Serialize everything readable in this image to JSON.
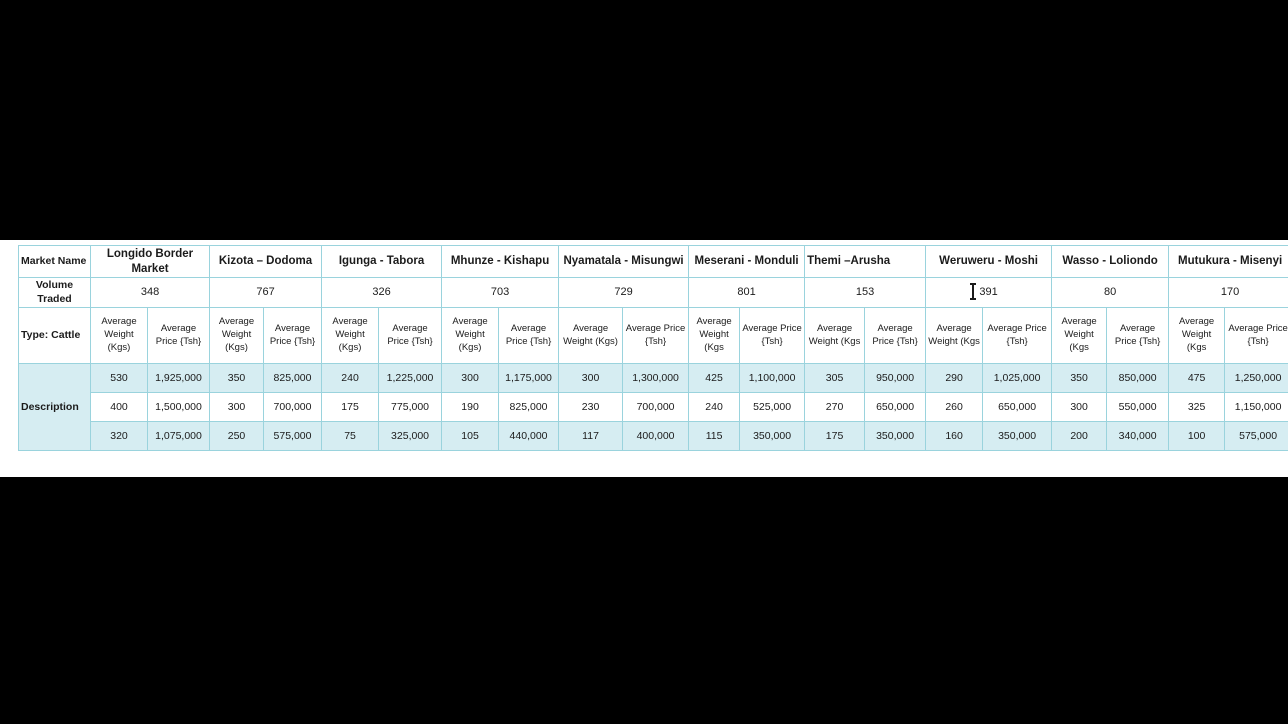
{
  "table": {
    "row_labels": {
      "market_name": "Market Name",
      "volume_traded": "Volume Traded",
      "type": "Type: Cattle",
      "description": "Description"
    },
    "sub_headers": {
      "weight": "Average Weight (Kgs)",
      "price": "Average Price {Tsh}"
    },
    "markets": [
      {
        "name": "Longido Border Market",
        "volume": "348",
        "weight_header": "Average Weight (Kgs)",
        "price_header": "Average Price {Tsh}",
        "weights": [
          "530",
          "400",
          "320"
        ],
        "prices": [
          "1,925,000",
          "1,500,000",
          "1,075,000"
        ]
      },
      {
        "name": "Kizota – Dodoma",
        "volume": "767",
        "weight_header": "Average Weight (Kgs)",
        "price_header": "Average Price {Tsh}",
        "weights": [
          "350",
          "300",
          "250"
        ],
        "prices": [
          "825,000",
          "700,000",
          "575,000"
        ]
      },
      {
        "name": "Igunga - Tabora",
        "volume": "326",
        "weight_header": "Average Weight (Kgs)",
        "price_header": "Average Price {Tsh}",
        "weights": [
          "240",
          "175",
          "75"
        ],
        "prices": [
          "1,225,000",
          "775,000",
          "325,000"
        ]
      },
      {
        "name": "Mhunze - Kishapu",
        "volume": "703",
        "weight_header": "Average Weight (Kgs)",
        "price_header": "Average Price {Tsh}",
        "weights": [
          "300",
          "190",
          "105"
        ],
        "prices": [
          "1,175,000",
          "825,000",
          "440,000"
        ]
      },
      {
        "name": "Nyamatala - Misungwi",
        "volume": "729",
        "weight_header": "Average Weight (Kgs)",
        "price_header": "Average Price {Tsh}",
        "weights": [
          "300",
          "230",
          "117"
        ],
        "prices": [
          "1,300,000",
          "700,000",
          "400,000"
        ]
      },
      {
        "name": "Meserani - Monduli",
        "volume": "801",
        "weight_header": "Average Weight (Kgs",
        "price_header": "Average Price {Tsh}",
        "weights": [
          "425",
          "240",
          "115"
        ],
        "prices": [
          "1,100,000",
          "525,000",
          "350,000"
        ]
      },
      {
        "name": "Themi –Arusha",
        "volume": "153",
        "weight_header": "Average Weight (Kgs",
        "price_header": "Average Price {Tsh}",
        "weights": [
          "305",
          "270",
          "175"
        ],
        "prices": [
          "950,000",
          "650,000",
          "350,000"
        ]
      },
      {
        "name": "Weruweru - Moshi",
        "volume": "391",
        "weight_header": "Average Weight (Kgs",
        "price_header": "Average Price {Tsh}",
        "weights": [
          "290",
          "260",
          "160"
        ],
        "prices": [
          "1,025,000",
          "650,000",
          "350,000"
        ]
      },
      {
        "name": "Wasso - Loliondo",
        "volume": "80",
        "weight_header": "Average Weight (Kgs",
        "price_header": "Average Price {Tsh}",
        "weights": [
          "350",
          "300",
          "200"
        ],
        "prices": [
          "850,000",
          "550,000",
          "340,000"
        ]
      },
      {
        "name": "Mutukura - Misenyi",
        "volume": "170",
        "weight_header": "Average Weight (Kgs",
        "price_header": "Average Price {Tsh}",
        "weights": [
          "475",
          "325",
          "100"
        ],
        "prices": [
          "1,250,000",
          "1,150,000",
          "575,000"
        ]
      }
    ]
  },
  "colors": {
    "page_background": "#000000",
    "sheet": "#ffffff",
    "cell_border": "#9ad3dd",
    "shade": "#d6edf2",
    "dark_separator": "#555b5e",
    "text": "#1b1b1b"
  }
}
